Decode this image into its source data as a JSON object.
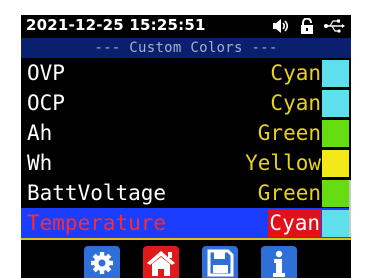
{
  "status": {
    "datetime": "2021-12-25 15:25:51",
    "icons": [
      "speaker-icon",
      "lock-icon",
      "usb-icon"
    ]
  },
  "section": {
    "title": "--- Custom Colors ---"
  },
  "rows": [
    {
      "label": "OVP",
      "value": "Cyan",
      "value_color": "#e8d21e",
      "swatch": "#5ee0ec",
      "selected": false
    },
    {
      "label": "OCP",
      "value": "Cyan",
      "value_color": "#e8d21e",
      "swatch": "#5ee0ec",
      "selected": false
    },
    {
      "label": "Ah",
      "value": "Green",
      "value_color": "#e8d21e",
      "swatch": "#66dd11",
      "selected": false
    },
    {
      "label": "Wh",
      "value": "Yellow",
      "value_color": "#e8d21e",
      "swatch": "#f2ea18",
      "selected": false
    },
    {
      "label": "BattVoltage",
      "value": "Green",
      "value_color": "#e8d21e",
      "swatch": "#66dd11",
      "selected": false
    },
    {
      "label": "Temperature",
      "value": "Cyan",
      "value_color": "#ffffff",
      "value_bg": "#e3101a",
      "swatch": "#5ee0ec",
      "selected": true
    }
  ],
  "toolbar": {
    "buttons": [
      {
        "icon": "gear-icon",
        "color": "#2f6fd8"
      },
      {
        "icon": "home-icon",
        "color": "#e01a1a"
      },
      {
        "icon": "save-icon",
        "color": "#2f6fd8"
      },
      {
        "icon": "info-icon",
        "color": "#2f6fd8"
      }
    ]
  },
  "colors": {
    "screen_bg": "#000000",
    "section_bg": "#0a1f6e",
    "selected_row_bg": "#1a3dff",
    "divider": "#d9c21a"
  }
}
